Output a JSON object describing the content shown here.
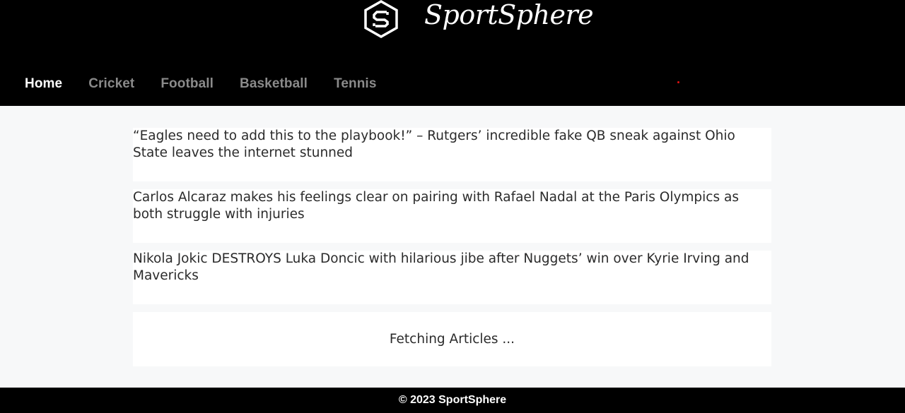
{
  "brand": {
    "logo_icon": "ss-hexagon-logo-icon",
    "name": "SportSphere"
  },
  "nav": {
    "items": [
      {
        "label": "Home",
        "active": true
      },
      {
        "label": "Cricket",
        "active": false
      },
      {
        "label": "Football",
        "active": false
      },
      {
        "label": "Basketball",
        "active": false
      },
      {
        "label": "Tennis",
        "active": false
      }
    ]
  },
  "articles": [
    {
      "title": "“Eagles need to add this to the playbook!” – Rutgers’ incredible fake QB sneak against Ohio State leaves the internet stunned"
    },
    {
      "title": "Carlos Alcaraz makes his feelings clear on pairing with Rafael Nadal at the Paris Olympics as both struggle with injuries"
    },
    {
      "title": "Nikola Jokic DESTROYS Luka Doncic with hilarious jibe after Nuggets’ win over Kyrie Irving and Mavericks"
    }
  ],
  "loading_text": "Fetching Articles ...",
  "footer": {
    "text": "© 2023 SportSphere"
  },
  "colors": {
    "header_bg": "#000000",
    "nav_active": "#ffffff",
    "nav_inactive": "#8a8a8a",
    "page_bg": "#f7f8f9"
  }
}
